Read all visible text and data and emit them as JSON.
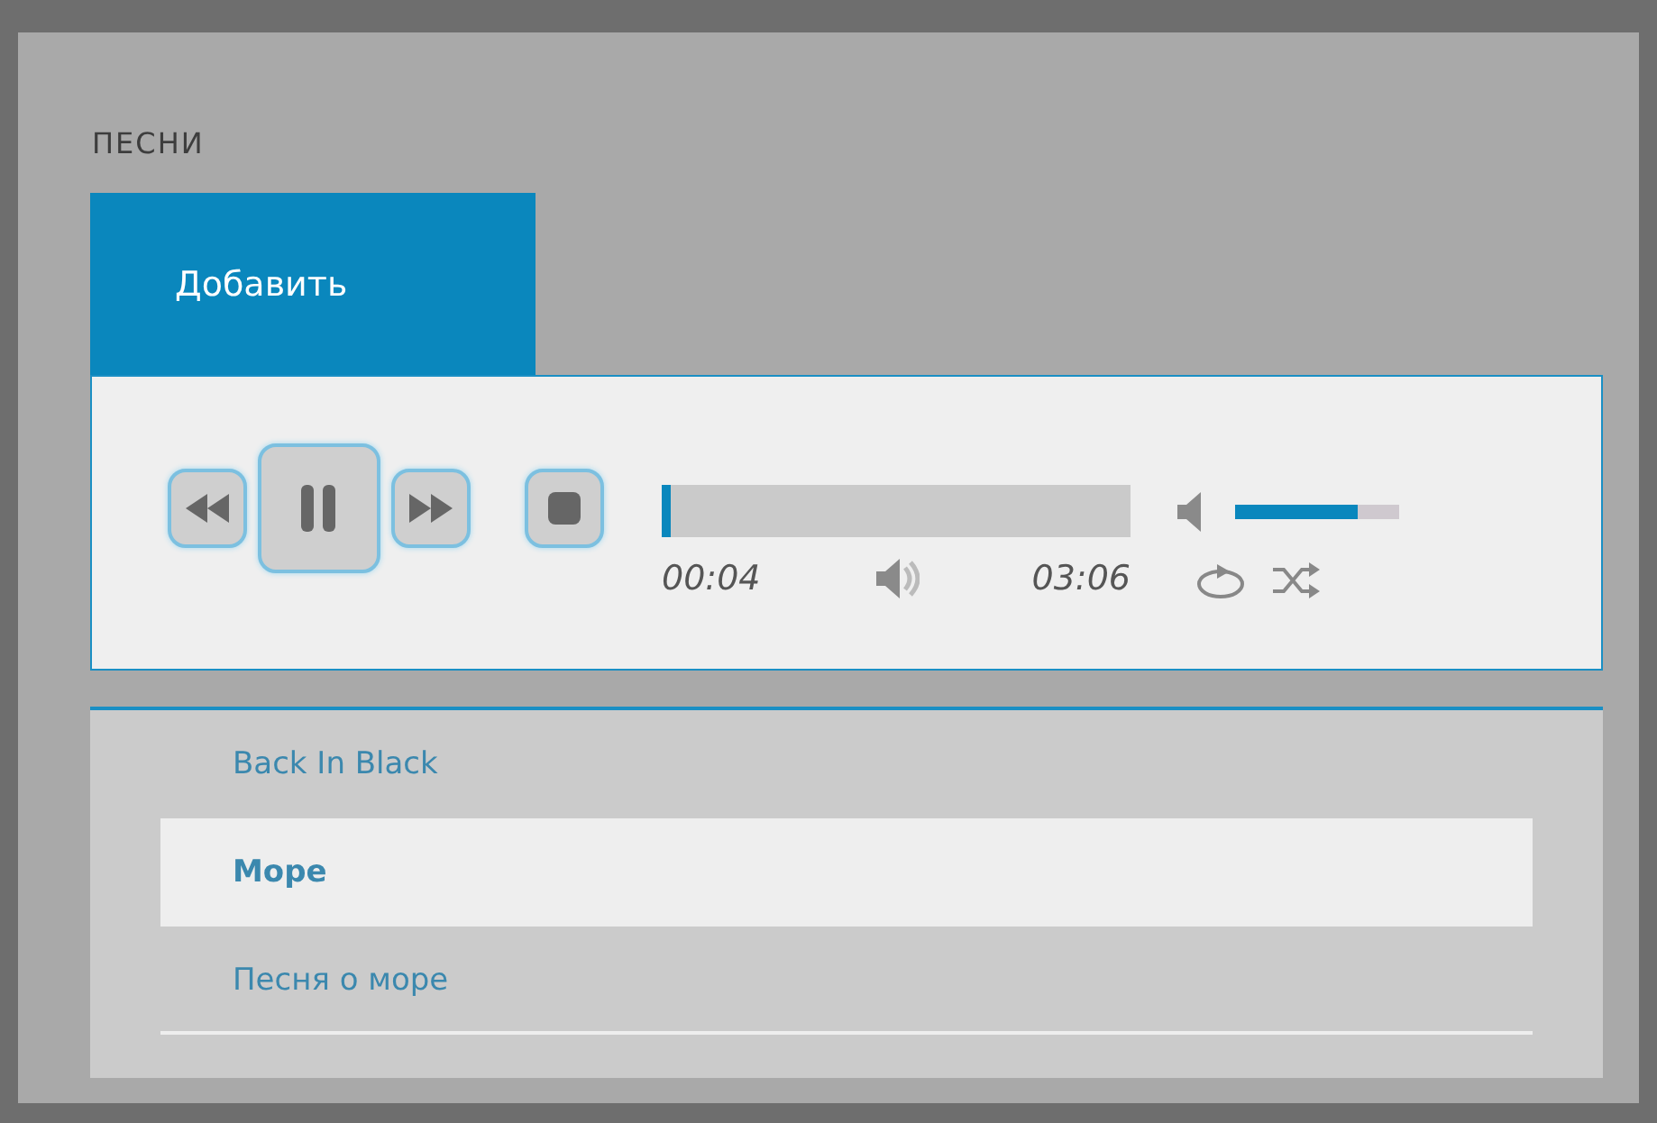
{
  "section_title": "ПЕСНИ",
  "tabs": [
    {
      "label": "Добавить",
      "selected": true
    }
  ],
  "player": {
    "playing": true,
    "progress": {
      "level": 0.02
    },
    "elapsed": "00:04",
    "duration": "03:06",
    "volume": {
      "level": 0.75
    }
  },
  "songs": [
    {
      "title": "Back In Black",
      "selected": false
    },
    {
      "title": "Море",
      "selected": true
    },
    {
      "title": "Песня о море",
      "selected": false
    }
  ]
}
